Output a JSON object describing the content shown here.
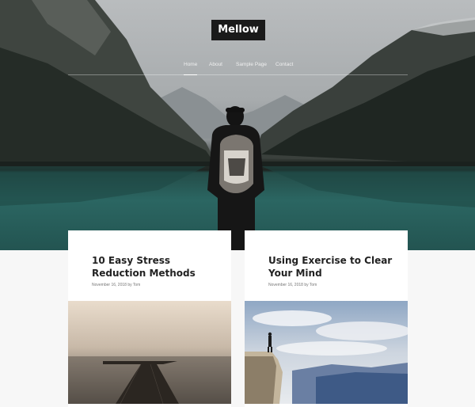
{
  "site": {
    "title": "Mellow"
  },
  "nav": {
    "items": [
      {
        "label": "Home",
        "active": true
      },
      {
        "label": "About",
        "active": false
      },
      {
        "label": "Sample Page",
        "active": false
      },
      {
        "label": "Contact",
        "active": false
      }
    ]
  },
  "posts": [
    {
      "title": "10 Easy Stress Reduction Methods",
      "date": "November 16, 2018",
      "by": "by",
      "author": "Tom",
      "image_icon": "pier-photo"
    },
    {
      "title": "Using Exercise to Clear Your Mind",
      "date": "November 16, 2018",
      "by": "by",
      "author": "Tom",
      "image_icon": "cliff-photo"
    }
  ],
  "colors": {
    "title_bg": "#1a1a1a",
    "lake": "#2b6662",
    "page_bg": "#f7f7f7"
  }
}
